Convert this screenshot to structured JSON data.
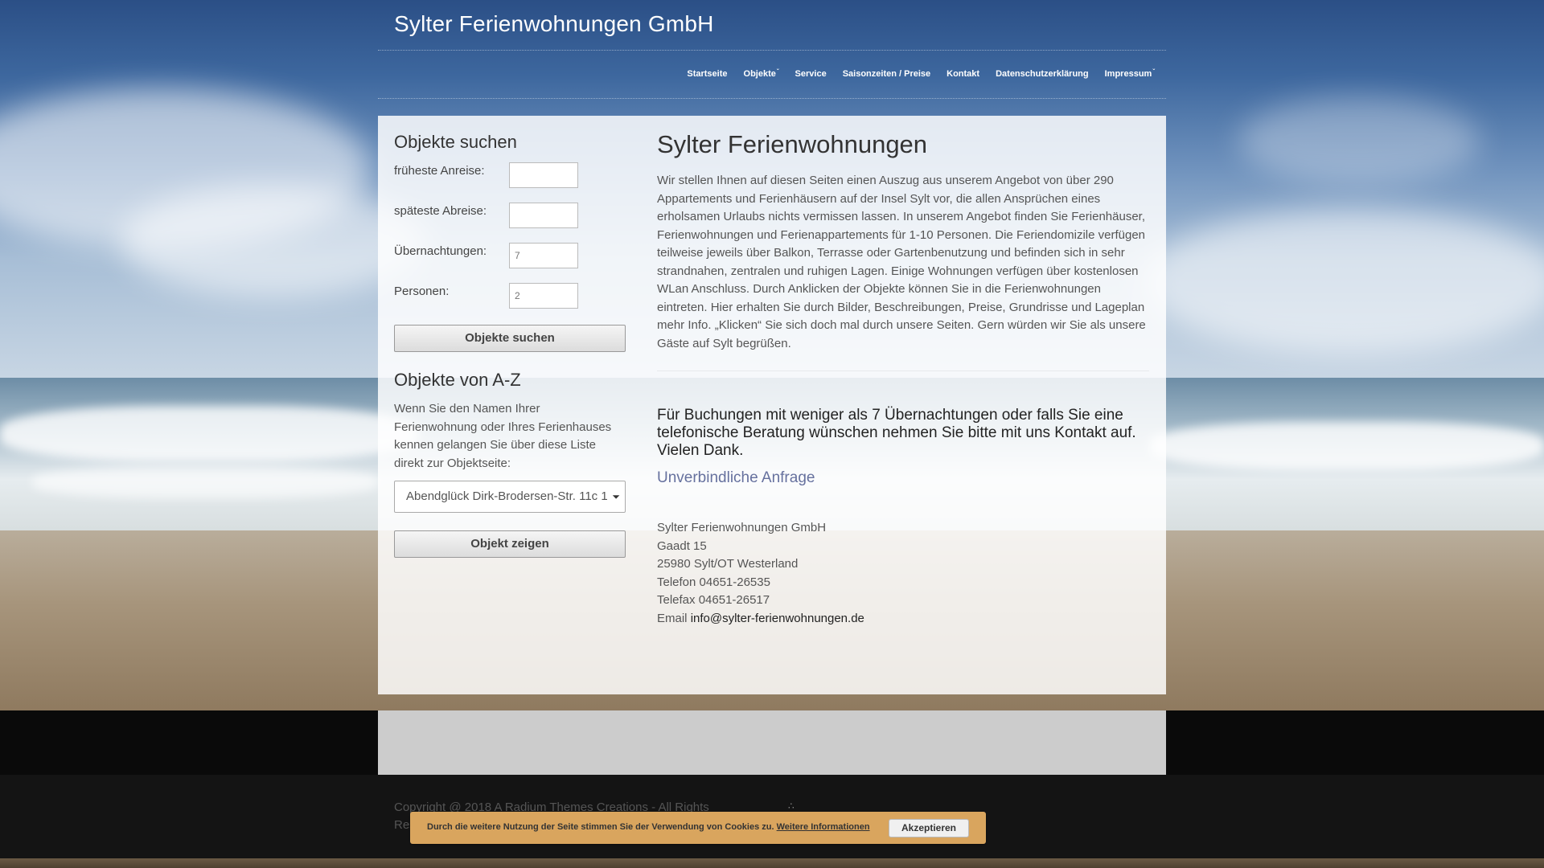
{
  "site": {
    "title": "Sylter Ferienwohnungen GmbH"
  },
  "nav": {
    "items": [
      {
        "label": "Startseite",
        "dropdown": false
      },
      {
        "label": "Objekte",
        "dropdown": true
      },
      {
        "label": "Service",
        "dropdown": false
      },
      {
        "label": "Saisonzeiten / Preise",
        "dropdown": false
      },
      {
        "label": "Kontakt",
        "dropdown": false
      },
      {
        "label": "Datenschutzerklärung",
        "dropdown": false
      },
      {
        "label": "Impressum",
        "dropdown": true
      }
    ]
  },
  "search": {
    "heading": "Objekte suchen",
    "arrival_label": "früheste Anreise:",
    "arrival_value": "",
    "departure_label": "späteste Abreise:",
    "departure_value": "",
    "nights_label": "Übernachtungen:",
    "nights_placeholder": "7",
    "persons_label": "Personen:",
    "persons_placeholder": "2",
    "submit_label": "Objekte suchen"
  },
  "az": {
    "heading": "Objekte von A-Z",
    "text": "Wenn Sie den Namen Ihrer Ferienwohnung oder Ihres Ferienhauses kennen gelangen Sie über diese Liste direkt zur Objektseite:",
    "selected_option": "Abendglück Dirk-Brodersen-Str. 11c 1",
    "button_label": "Objekt zeigen"
  },
  "main": {
    "title": "Sylter Ferienwohnungen",
    "intro": "Wir stellen Ihnen auf diesen Seiten einen Auszug aus unserem Angebot von über 290 Appartements und Ferienhäusern auf der Insel Sylt vor, die allen Ansprüchen eines erholsamen Urlaubs nichts vermissen lassen. In unserem Angebot finden Sie Ferienhäuser, Ferienwohnungen und Ferienappartements für 1-10 Personen. Die Feriendomizile verfügen teilweise jeweils über Balkon, Terrasse oder  Gartenbenutzung und befinden sich in sehr strandnahen, zentralen und ruhigen Lagen. Einige Wohnungen verfügen über kostenlosen WLan Anschluss. Durch Anklicken der Objekte können Sie in die Ferienwohnungen eintreten. Hier erhalten Sie durch Bilder, Beschreibungen, Preise, Grundrisse und Lageplan mehr Info. „Klicken“ Sie sich doch mal durch unsere Seiten. Gern würden wir Sie als unsere Gäste auf Sylt begrüßen.",
    "notice": "Für Buchungen mit weniger als 7 Übernachtungen oder falls Sie eine telefonische Beratung wünschen nehmen Sie bitte mit uns Kontakt auf. Vielen Dank.",
    "inquiry_link": "Unverbindliche Anfrage",
    "address": {
      "company": "Sylter Ferienwohnungen GmbH",
      "street": "Gaadt 15",
      "city": "25980 Sylt/OT Westerland",
      "phone": "Telefon 04651-26535",
      "fax": "Telefax 04651-26517",
      "email_prefix": "Email ",
      "email": "info@sylter-ferienwohnungen.de"
    }
  },
  "footer": {
    "copyright": "Copyright @ 2018 A Radium Themes Creations - All Rights Reserved"
  },
  "cookie": {
    "message": "Durch die weitere Nutzung der Seite stimmen Sie der Verwendung von Cookies zu.",
    "more_link": "Weitere Informationen",
    "accept_label": "Akzeptieren"
  },
  "colors": {
    "link_accent": "#66719e",
    "cookie_bar": "#d9a55e",
    "footer_bg": "#141414"
  }
}
